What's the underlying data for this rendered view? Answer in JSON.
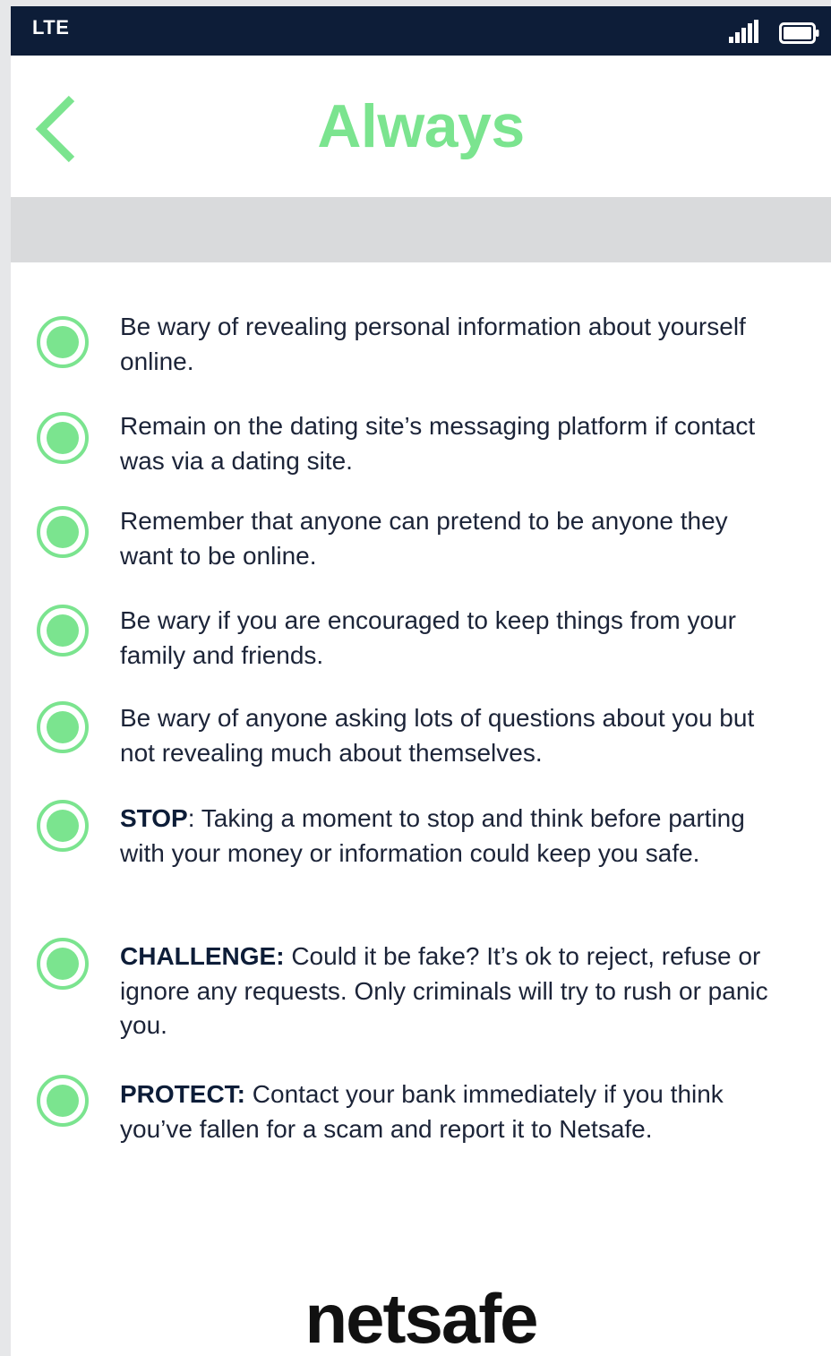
{
  "status_bar": {
    "carrier": "LTE",
    "signal_icon": "cellular-signal-icon",
    "battery_icon": "battery-icon"
  },
  "header": {
    "back_icon": "chevron-left-icon",
    "title": "Always"
  },
  "tips": [
    {
      "lead": "",
      "text": "Be wary of revealing personal information about yourself online."
    },
    {
      "lead": "",
      "text": "Remain on the dating site’s messaging platform if contact was via a dating site."
    },
    {
      "lead": "",
      "text": "Remember that anyone can pretend to be anyone they want to be online."
    },
    {
      "lead": "",
      "text": "Be wary if you are encouraged to keep things from your family and friends."
    },
    {
      "lead": "",
      "text": "Be wary of anyone asking lots of questions about you but not revealing much about themselves."
    },
    {
      "lead": "STOP",
      "text": ": Taking a moment to stop and think before parting with your money or information could keep you safe."
    },
    {
      "lead": "CHALLENGE:",
      "text": " Could it be fake? It’s ok to reject, refuse or ignore any requests. Only criminals will try to rush or panic you."
    },
    {
      "lead": "PROTECT:",
      "text": " Contact your bank immediately if you think you’ve fallen for a scam and report it to Netsafe."
    }
  ],
  "footer": {
    "logo_text": "netsafe"
  },
  "colors": {
    "accent": "#7be48f",
    "status_bar": "#0d1d38",
    "band": "#d9dadc",
    "text": "#1c2438"
  }
}
